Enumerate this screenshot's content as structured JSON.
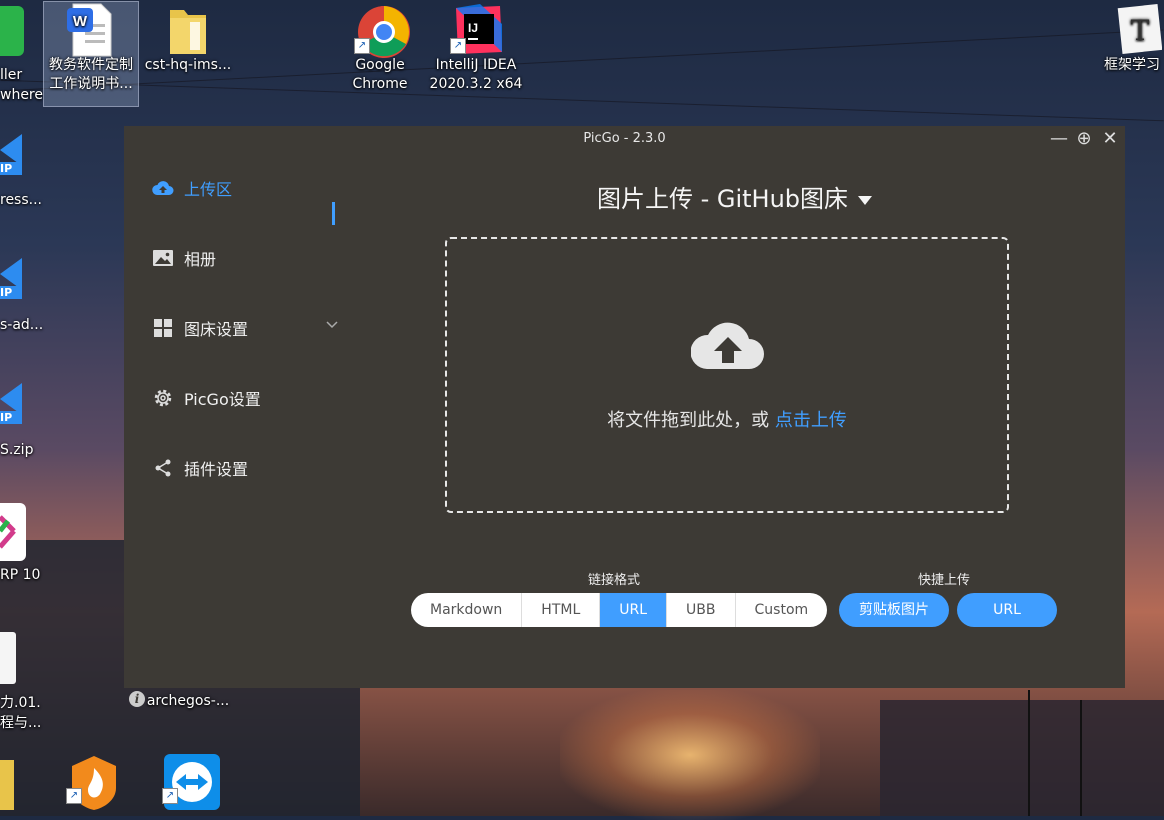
{
  "desktop": {
    "icons": [
      {
        "label1": "教务软件定制",
        "label2": "工作说明书..."
      },
      {
        "label1": "cst-hq-ims...",
        "label2": ""
      },
      {
        "label1": "Google",
        "label2": "Chrome"
      },
      {
        "label1": "IntelliJ IDEA",
        "label2": "2020.3.2 x64"
      },
      {
        "label1": "框架学习",
        "label2": ""
      },
      {
        "label1": "archegos-...",
        "label2": ""
      }
    ],
    "edge": {
      "a1": "ller",
      "a2": "where",
      "b1": "ress...",
      "c1": "s-ad...",
      "d1": "S.zip",
      "e1": "RP 10",
      "f1": "力.01.",
      "f2": "程与...",
      "zip": "IP"
    },
    "glyphs": {
      "word": "W",
      "intellij": "IJ",
      "typora": "T"
    }
  },
  "window": {
    "title": "PicGo - 2.3.0",
    "controls": {
      "minimize": "—",
      "maximize": "⊕",
      "close": "✕"
    },
    "sidebar": {
      "items": [
        {
          "label": "上传区",
          "icon": "cloud-upload-icon",
          "active": true
        },
        {
          "label": "相册",
          "icon": "image-icon"
        },
        {
          "label": "图床设置",
          "icon": "grid-icon",
          "has_submenu": true
        },
        {
          "label": "PicGo设置",
          "icon": "gear-icon"
        },
        {
          "label": "插件设置",
          "icon": "share-icon"
        }
      ],
      "info": "i"
    },
    "main": {
      "title": "图片上传 - GitHub图床",
      "drop_text": "将文件拖到此处，或 ",
      "drop_link": "点击上传",
      "link_format_label": "链接格式",
      "formats": [
        "Markdown",
        "HTML",
        "URL",
        "UBB",
        "Custom"
      ],
      "selected_format": "URL",
      "quick_upload_label": "快捷上传",
      "quick_buttons": [
        "剪贴板图片",
        "URL"
      ]
    },
    "colors": {
      "accent": "#409eff",
      "background": "#3d3a35"
    }
  }
}
